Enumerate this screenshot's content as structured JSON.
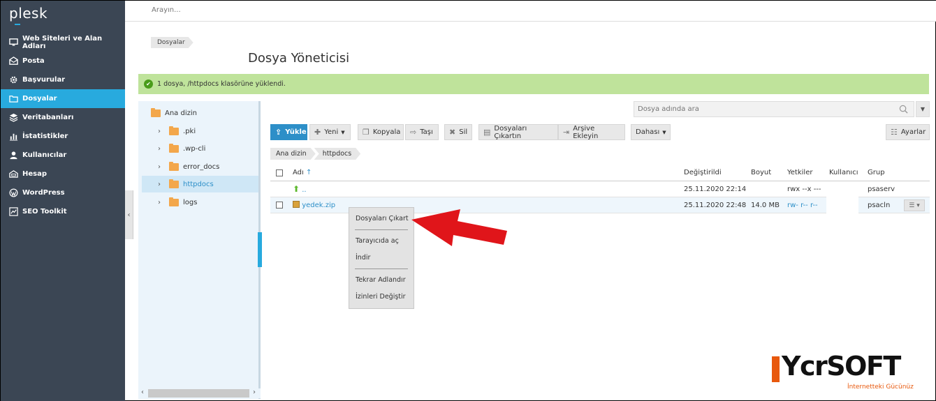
{
  "brand": {
    "logo": "plesk"
  },
  "sidebar": {
    "items": [
      {
        "label": "Web Siteleri ve Alan Adları",
        "icon": "monitor-icon"
      },
      {
        "label": "Posta",
        "icon": "mail-icon"
      },
      {
        "label": "Başvurular",
        "icon": "gear-icon"
      },
      {
        "label": "Dosyalar",
        "icon": "folder-icon",
        "active": true
      },
      {
        "label": "Veritabanları",
        "icon": "layers-icon"
      },
      {
        "label": "İstatistikler",
        "icon": "chart-icon"
      },
      {
        "label": "Kullanıcılar",
        "icon": "user-icon"
      },
      {
        "label": "Hesap",
        "icon": "account-icon"
      },
      {
        "label": "WordPress",
        "icon": "wordpress-icon"
      },
      {
        "label": "SEO Toolkit",
        "icon": "seo-icon"
      }
    ],
    "collapse_label": "‹"
  },
  "topbar": {
    "search_placeholder": "Arayın..."
  },
  "page": {
    "breadcrumb": "Dosyalar",
    "title": "Dosya Yöneticisi"
  },
  "alert": {
    "message": "1 dosya, /httpdocs klasörüne yüklendi."
  },
  "tree": {
    "root": "Ana dizin",
    "items": [
      ".pki",
      ".wp-cli",
      "error_docs",
      "httpdocs",
      "logs"
    ],
    "selected": "httpdocs"
  },
  "search": {
    "placeholder": "Dosya adında ara"
  },
  "toolbar": {
    "upload": "Yükle",
    "new": "Yeni",
    "copy": "Kopyala",
    "move": "Taşı",
    "delete": "Sil",
    "extract": "Dosyaları Çıkartın",
    "archive": "Arşive Ekleyin",
    "more": "Dahası",
    "settings": "Ayarlar"
  },
  "path": [
    "Ana dizin",
    "httpdocs"
  ],
  "table": {
    "headers": {
      "name": "Adı",
      "modified": "Değiştirildi",
      "size": "Boyut",
      "perms": "Yetkiler",
      "user": "Kullanıcı",
      "group": "Grup"
    },
    "rows": [
      {
        "name": "..",
        "modified": "25.11.2020 22:14",
        "size": "",
        "perms": "rwx --x ---",
        "group": "psaserv"
      },
      {
        "name": "yedek.zip",
        "modified": "25.11.2020 22:48",
        "size": "14.0 MB",
        "perms": "rw- r-- r--",
        "group": "psacln"
      }
    ]
  },
  "context_menu": {
    "items": [
      "Dosyaları Çıkart",
      "Tarayıcıda aç",
      "İndir",
      "Tekrar Adlandır",
      "İzinleri Değiştir"
    ]
  },
  "watermark": {
    "name": "YcrSOFT",
    "tagline": "İnternetteki Gücünüz"
  },
  "colors": {
    "sidebar_bg": "#3b4654",
    "accent": "#28aade",
    "success_bg": "#bfe39b",
    "brand_orange": "#e8580c",
    "arrow_red": "#e0151a"
  }
}
